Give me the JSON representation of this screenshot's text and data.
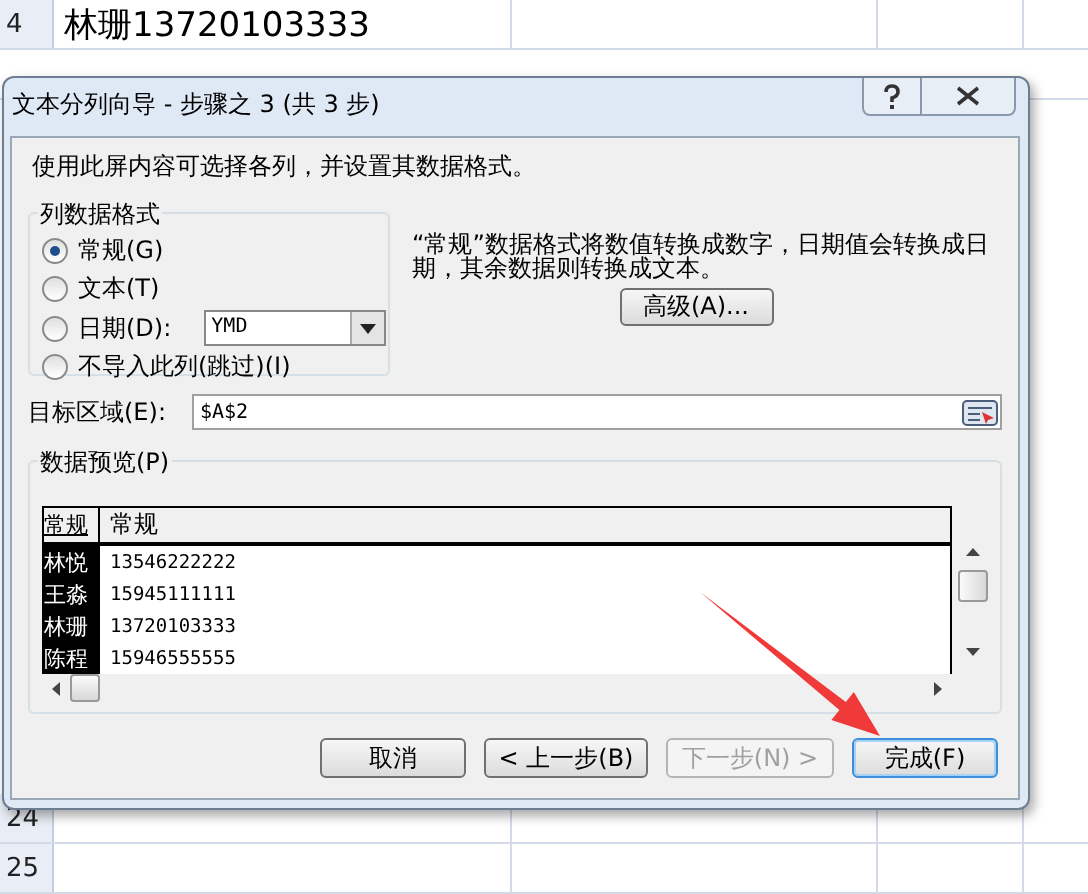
{
  "sheet": {
    "top_rows": [
      {
        "number": "4",
        "text": "林珊13720103333"
      }
    ],
    "bottom_rows": [
      {
        "number": "24"
      },
      {
        "number": "25"
      }
    ]
  },
  "dialog": {
    "title": "文本分列向导 - 步骤之 3 (共 3 步)",
    "intro": "使用此屏内容可选择各列，并设置其数据格式。",
    "format_group": {
      "title": "列数据格式",
      "options": [
        {
          "label": "常规(G)",
          "selected": true,
          "kind": "plain"
        },
        {
          "label": "文本(T)",
          "selected": false,
          "kind": "plain"
        },
        {
          "label": "日期(D):",
          "selected": false,
          "kind": "date",
          "value": "YMD"
        },
        {
          "label": "不导入此列(跳过)(I)",
          "selected": false,
          "kind": "plain"
        }
      ]
    },
    "description": "“常规”数据格式将数值转换成数字，日期值会转换成日期，其余数据则转换成文本。",
    "advanced_button": "高级(A)...",
    "destination": {
      "label": "目标区域(E):",
      "value": "$A$2"
    },
    "preview": {
      "title": "数据预览(P)",
      "columns": [
        {
          "header": "常规",
          "selected": true
        },
        {
          "header": "常规",
          "selected": false
        }
      ],
      "rows": [
        [
          "林悦",
          "13546222222"
        ],
        [
          "王淼",
          "15945111111"
        ],
        [
          "林珊",
          "13720103333"
        ],
        [
          "陈程",
          "15946555555"
        ]
      ]
    },
    "buttons": [
      {
        "label": "取消",
        "disabled": false,
        "default": false
      },
      {
        "label": "< 上一步(B)",
        "disabled": false,
        "default": false
      },
      {
        "label": "下一步(N) >",
        "disabled": true,
        "default": false
      },
      {
        "label": "完成(F)",
        "disabled": false,
        "default": true
      }
    ]
  }
}
